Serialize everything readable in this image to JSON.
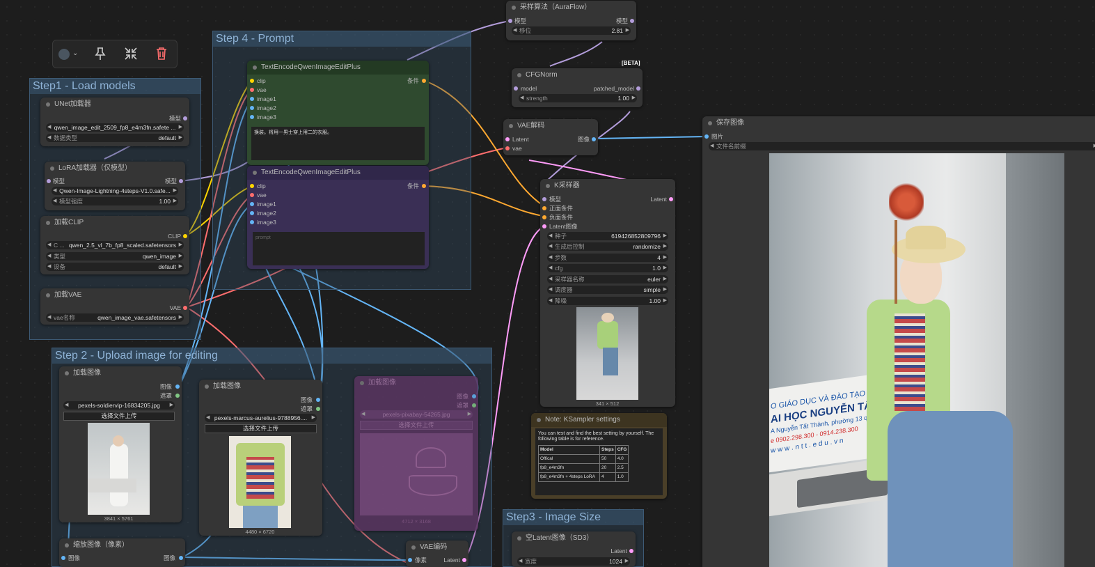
{
  "toolbar": {
    "color_icon": "color-circle-icon",
    "pin_icon": "pin-icon",
    "collapse_icon": "collapse-icon",
    "delete_icon": "trash-icon"
  },
  "groups": {
    "step1": "Step1 - Load models",
    "step2": "Step 2 - Upload image for editing",
    "step3": "Step3 - Image Size",
    "step4": "Step 4 - Prompt"
  },
  "unet": {
    "title": "UNet加载器",
    "out": "模型",
    "model": "qwen_image_edit_2509_fp8_e4m3fn.safete ...",
    "dtype_label": "数据类型",
    "dtype": "default"
  },
  "lora": {
    "title": "LoRA加载器（仅模型）",
    "in": "模型",
    "out": "模型",
    "name": "Qwen-Image-Lightning-4steps-V1.0.safe...",
    "strength_label": "模型强度",
    "strength": "1.00"
  },
  "clip": {
    "title": "加载CLIP",
    "out": "CLIP",
    "name_label": "C ...",
    "name": "qwen_2.5_vl_7b_fp8_scaled.safetensors",
    "type_label": "类型",
    "type": "qwen_image",
    "device_label": "设备",
    "device": "default"
  },
  "vae_loader": {
    "title": "加载VAE",
    "out": "VAE",
    "name_label": "vae名称",
    "name": "qwen_image_vae.safetensors"
  },
  "enc1": {
    "title": "TextEncodeQwenImageEditPlus",
    "inputs": [
      "clip",
      "vae",
      "image1",
      "image2",
      "image3"
    ],
    "out": "条件",
    "prompt": "换装。将用一男士穿上用二的衣服。"
  },
  "enc2": {
    "title": "TextEncodeQwenImageEditPlus",
    "inputs": [
      "clip",
      "vae",
      "image1",
      "image2",
      "image3"
    ],
    "out": "条件",
    "placeholder": "prompt"
  },
  "sampling": {
    "title": "采样算法（AuraFlow）",
    "in": "模型",
    "out": "模型",
    "shift_label": "移位",
    "shift": "2.81"
  },
  "cfgnorm": {
    "badge": "[BETA]",
    "title": "CFGNorm",
    "in": "model",
    "out": "patched_model",
    "strength_label": "strength",
    "strength": "1.00"
  },
  "vaedecode": {
    "title": "VAE解码",
    "in1": "Latent",
    "in2": "vae",
    "out": "图像"
  },
  "save": {
    "title": "保存图像",
    "in": "图片",
    "prefix_label": "文件名前缀"
  },
  "ksampler": {
    "title": "K采样器",
    "inputs": [
      "模型",
      "正面条件",
      "负面条件",
      "Latent图像"
    ],
    "out": "Latent",
    "widgets": [
      {
        "l": "种子",
        "v": "619426852809796"
      },
      {
        "l": "生成后控制",
        "v": "randomize"
      },
      {
        "l": "步数",
        "v": "4"
      },
      {
        "l": "cfg",
        "v": "1.0"
      },
      {
        "l": "采样器名称",
        "v": "euler"
      },
      {
        "l": "调度器",
        "v": "simple"
      },
      {
        "l": "降噪",
        "v": "1.00"
      }
    ],
    "preview_size": "341 × 512"
  },
  "note": {
    "title": "Note: KSampler settings",
    "text": "You can test and find the best setting by yourself. The following table is for reference.",
    "headers": [
      "Model",
      "Steps",
      "CFG"
    ],
    "rows": [
      [
        "Offical",
        "50",
        "4.0"
      ],
      [
        "fp8_e4m3fn",
        "20",
        "2.5"
      ],
      [
        "fp8_e4m3fn + 4steps LoRA",
        "4",
        "1.0"
      ]
    ]
  },
  "load1": {
    "title": "加载图像",
    "out1": "图像",
    "out2": "遮罩",
    "file": "pexels-soldiervip-16834205.jpg",
    "upload": "选择文件上传",
    "size": "3841 × 5761"
  },
  "load2": {
    "title": "加载图像",
    "out1": "图像",
    "out2": "遮罩",
    "file": "pexels-marcus-aurelius-9788956....",
    "upload": "选择文件上传",
    "size": "4480 × 6720"
  },
  "load3": {
    "title": "加载图像",
    "out1": "图像",
    "out2": "遮罩",
    "file": "pexels-pixabay-54265.jpg",
    "upload": "选择文件上传",
    "size": "4712 × 3168"
  },
  "scale": {
    "title": "缩放图像（像素）",
    "in": "图像",
    "out": "图像"
  },
  "vaeencode": {
    "title": "VAE编码",
    "in": "像素",
    "out": "Latent"
  },
  "emptylatent": {
    "title": "空Latent图像（SD3）",
    "out": "Latent",
    "width_label": "宽度",
    "width": "1024"
  },
  "banner": {
    "line1": "O GIÁO DỤC VÀ ĐÀO TẠO",
    "line2": "AI HỌC NGUYỄN TẤT THÀ",
    "line3": "A Nguyễn Tất Thành, phường 13 quận 4",
    "line4": "e 0902.298.300 - 0914.238.300",
    "line5": "w w w . n t t . e d u . v n"
  },
  "colors": {
    "clip": "#ffd500",
    "vae": "#ff6e6e",
    "image": "#64b5f6",
    "model": "#b39ddb",
    "cond": "#ffa931",
    "latent": "#ff9cf9",
    "mask": "#81c784"
  }
}
